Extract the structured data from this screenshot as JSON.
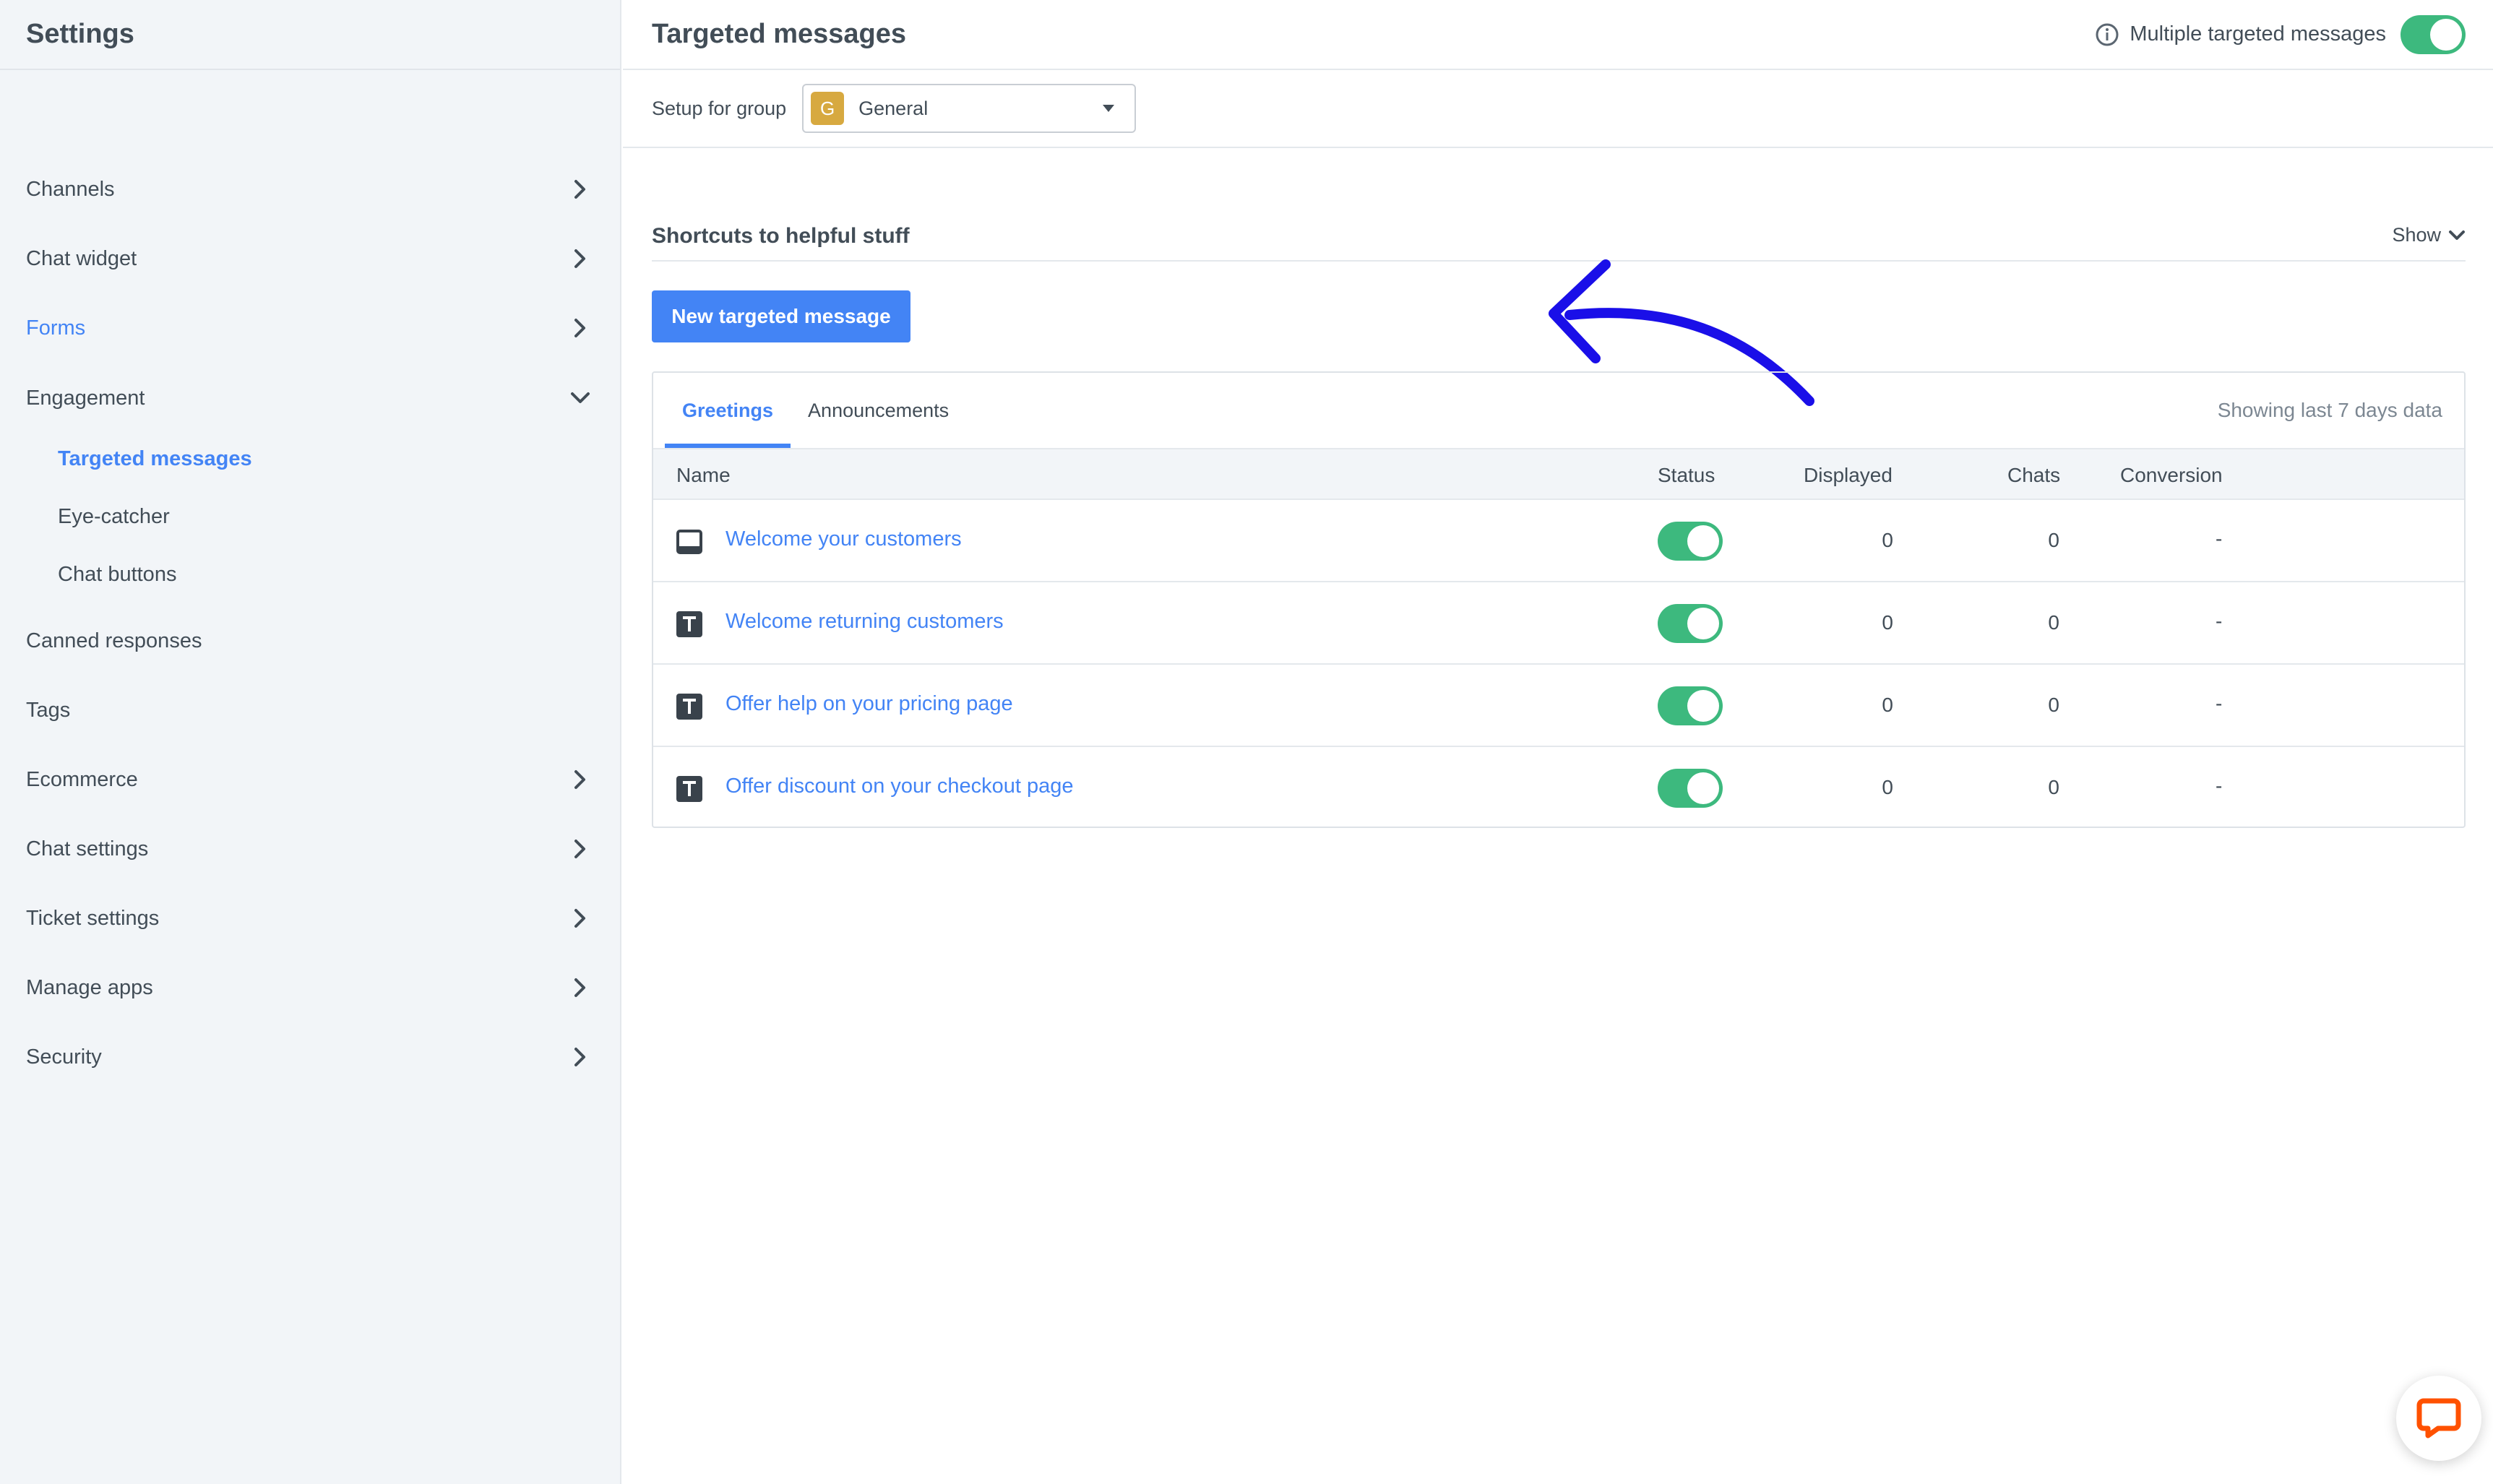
{
  "sidebar": {
    "title": "Settings",
    "items": [
      {
        "label": "Channels",
        "icon": "chevron-right-icon"
      },
      {
        "label": "Chat widget",
        "icon": "chevron-right-icon"
      },
      {
        "label": "Forms",
        "icon": "chevron-right-icon"
      },
      {
        "label": "Engagement",
        "icon": "chevron-down-icon"
      },
      {
        "label": "Targeted messages"
      },
      {
        "label": "Eye-catcher"
      },
      {
        "label": "Chat buttons"
      },
      {
        "label": "Canned responses"
      },
      {
        "label": "Tags"
      },
      {
        "label": "Ecommerce",
        "icon": "chevron-right-icon"
      },
      {
        "label": "Chat settings",
        "icon": "chevron-right-icon"
      },
      {
        "label": "Ticket settings",
        "icon": "chevron-right-icon"
      },
      {
        "label": "Manage apps",
        "icon": "chevron-right-icon"
      },
      {
        "label": "Security",
        "icon": "chevron-right-icon"
      }
    ]
  },
  "header": {
    "title": "Targeted messages",
    "multiple_label": "Multiple targeted messages",
    "multiple_enabled": true
  },
  "group": {
    "label": "Setup for group",
    "avatar_letter": "G",
    "value": "General"
  },
  "shortcuts": {
    "title": "Shortcuts to helpful stuff",
    "show_label": "Show"
  },
  "new_button_label": "New targeted message",
  "tabs": [
    {
      "label": "Greetings",
      "active": true
    },
    {
      "label": "Announcements",
      "active": false
    }
  ],
  "showing_text": "Showing last 7 days data",
  "table": {
    "headers": {
      "name": "Name",
      "status": "Status",
      "displayed": "Displayed",
      "chats": "Chats",
      "conversion": "Conversion"
    },
    "rows": [
      {
        "icon": "bar-layout-icon",
        "name": "Welcome your customers",
        "enabled": true,
        "displayed": "0",
        "chats": "0",
        "conversion": "-"
      },
      {
        "icon": "text-t-icon",
        "name": "Welcome returning customers",
        "enabled": true,
        "displayed": "0",
        "chats": "0",
        "conversion": "-"
      },
      {
        "icon": "text-t-icon",
        "name": "Offer help on your pricing page",
        "enabled": true,
        "displayed": "0",
        "chats": "0",
        "conversion": "-"
      },
      {
        "icon": "text-t-icon",
        "name": "Offer discount on your checkout page",
        "enabled": true,
        "displayed": "0",
        "chats": "0",
        "conversion": "-"
      }
    ]
  },
  "colors": {
    "accent": "#4384f5",
    "toggle_on": "#3db97e",
    "annotation_arrow": "#1a0fe8",
    "chat_icon": "#ff5100"
  }
}
